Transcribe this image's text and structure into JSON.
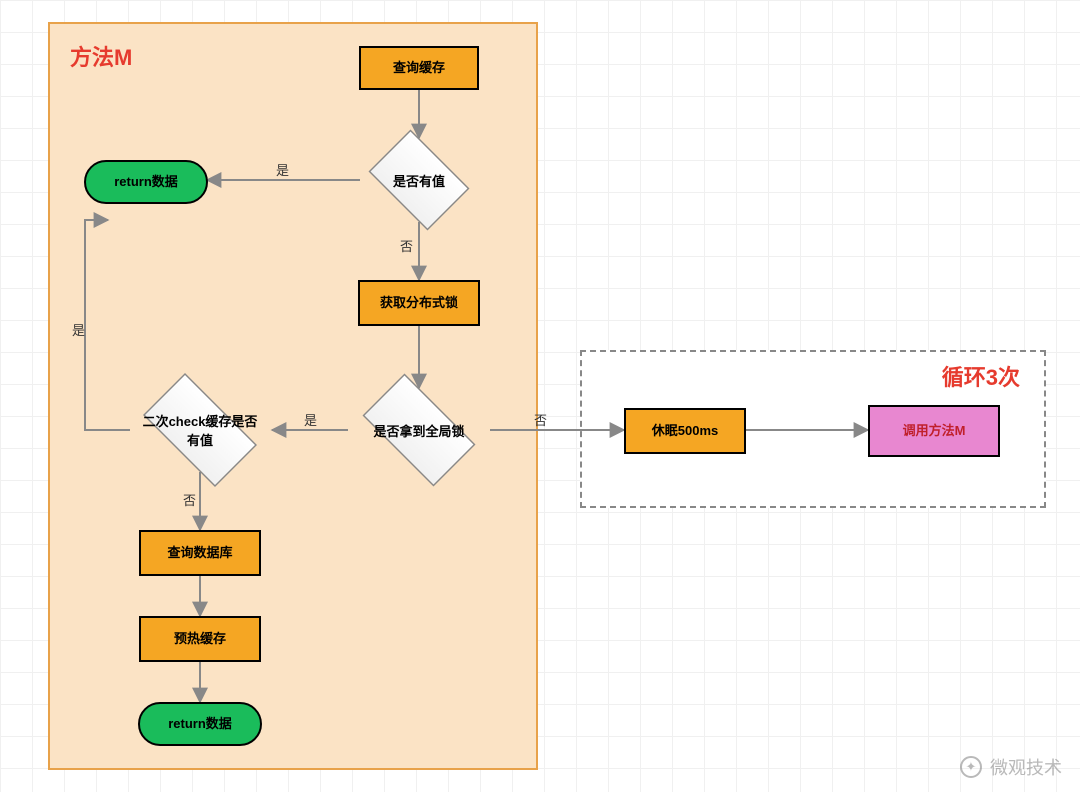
{
  "containers": {
    "main": {
      "title": "方法M",
      "title_color": "#e63b2e"
    },
    "loop": {
      "title": "循环3次",
      "title_color": "#e63b2e"
    }
  },
  "nodes": {
    "query_cache": {
      "label": "查询缓存"
    },
    "has_value": {
      "label": "是否有值"
    },
    "return_top": {
      "label": "return数据"
    },
    "get_lock": {
      "label": "获取分布式锁"
    },
    "got_global_lock": {
      "label": "是否拿到全局锁"
    },
    "recheck_cache": {
      "label": "二次check缓存是否有值"
    },
    "query_db": {
      "label": "查询数据库"
    },
    "warm_cache": {
      "label": "预热缓存"
    },
    "return_bottom": {
      "label": "return数据"
    },
    "sleep": {
      "label": "休眠500ms"
    },
    "call_method_m": {
      "label": "调用方法M"
    }
  },
  "edges": {
    "yes": "是",
    "no": "否"
  },
  "colors": {
    "process": "#f5a623",
    "terminal": "#1abc5b",
    "container_main": "#fbe3c5",
    "container_main_border": "#e8a24a",
    "call": "#e887d0",
    "arrow": "#888"
  },
  "watermark": {
    "text": "微观技术",
    "icon": "wechat-icon"
  }
}
